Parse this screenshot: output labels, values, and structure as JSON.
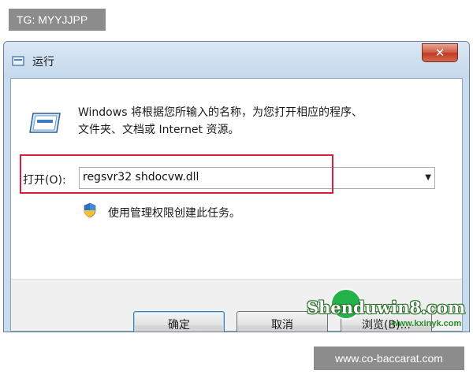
{
  "tag": "TG: MYYJJPP",
  "window": {
    "title": "运行",
    "title_icon": "run-icon",
    "close_glyph": "✕",
    "description_line1": "Windows 将根据您所输入的名称，为您打开相应的程序、",
    "description_line2": "文件夹、文档或 Internet 资源。",
    "open_label": "打开(O):",
    "open_value": "regsvr32 shdocvw.dll",
    "dropdown_arrow": "▼",
    "admin_note": "使用管理权限创建此任务。",
    "buttons": {
      "ok": "确定",
      "cancel": "取消",
      "browse": "浏览(B)..."
    }
  },
  "watermark": {
    "logo_text": "Shenduwin8.com",
    "url": "www.kxinyk.com"
  },
  "site_tag": "www.co-baccarat.com",
  "colors": {
    "highlight_outline": "#d4203c",
    "title_bar": "#c9dcef",
    "close_button": "#c03a22",
    "tag_background": "#8c8c8c"
  }
}
